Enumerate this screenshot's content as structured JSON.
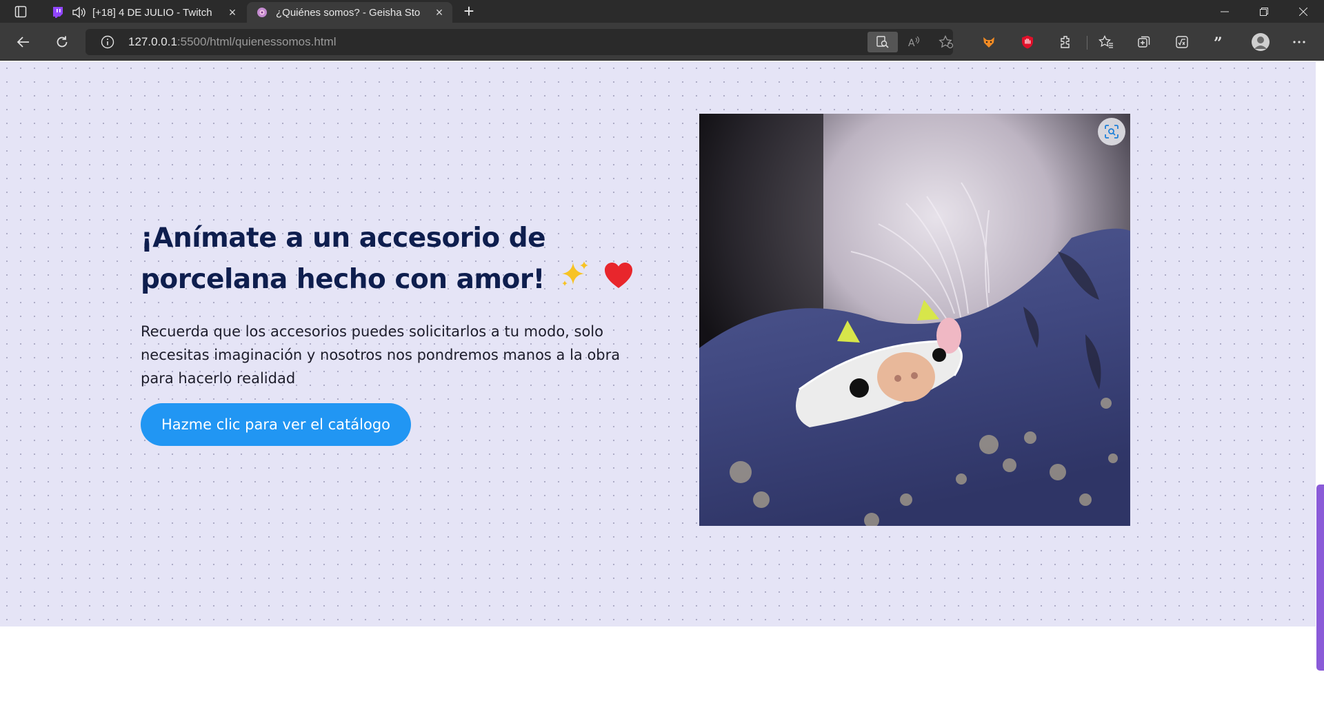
{
  "browser": {
    "tabs": [
      {
        "title": "[+18] 4 DE JULIO - Twitch",
        "favicon": "twitch-icon",
        "audio": "speaker-icon"
      },
      {
        "title": "¿Quiénes somos? - Geisha Store",
        "favicon": "geisha-store-icon"
      }
    ],
    "address": {
      "host": "127.0.0.1",
      "rest": ":5500/html/quienessomos.html"
    },
    "accent": "#2196f3"
  },
  "hero": {
    "headline_line1": "¡Anímate a un accesorio de",
    "headline_line2": "porcelana hecho con amor!",
    "sparkles": "✨",
    "heart": "❤️",
    "body": "Recuerda que los accesorios puedes solicitarlos a tu modo, solo necesitas imaginación y nosotros nos pondremos manos a la obra para hacerlo realidad",
    "cta_label": "Hazme clic para ver el catálogo"
  },
  "colors": {
    "page_bg": "#e5e4f6",
    "headline": "#0e1e4e",
    "button": "#2196f3",
    "scrollbar": "#8a5bd8"
  }
}
